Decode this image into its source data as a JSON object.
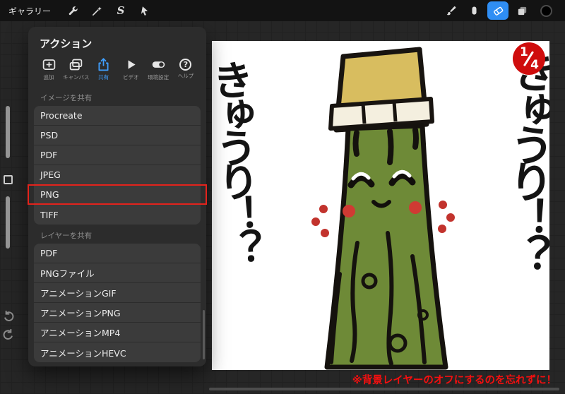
{
  "topbar": {
    "gallery_label": "ギャラリー",
    "selected_tool": "eraser"
  },
  "glyphs": {
    "selection": "S",
    "help": "?"
  },
  "action_panel": {
    "title": "アクション",
    "tabs": [
      {
        "label": "追加"
      },
      {
        "label": "キャンバス"
      },
      {
        "label": "共有"
      },
      {
        "label": "ビデオ"
      },
      {
        "label": "環境設定"
      },
      {
        "label": "ヘルプ"
      }
    ],
    "active_tab": "共有",
    "image_share": {
      "header": "イメージを共有",
      "items": [
        "Procreate",
        "PSD",
        "PDF",
        "JPEG",
        "PNG",
        "TIFF"
      ]
    },
    "layer_share": {
      "header": "レイヤーを共有",
      "items": [
        "PDF",
        "PNGファイル",
        "アニメーションGIF",
        "アニメーションPNG",
        "アニメーションMP4",
        "アニメーションHEVC"
      ]
    },
    "highlighted_item": "PNG"
  },
  "page_badge": {
    "current": "1",
    "total": "4"
  },
  "annotation": {
    "note": "※背景レイヤーのオフにするのを忘れずに！"
  },
  "artwork": {
    "subject": "cucumber character with yellow cap",
    "left_text": "きゅうり！？",
    "right_text": "きゅうり！？"
  },
  "colors": {
    "accent": "#3f9fff",
    "annotation_red": "#f50f0f",
    "badge_red": "#cf0d0d"
  }
}
